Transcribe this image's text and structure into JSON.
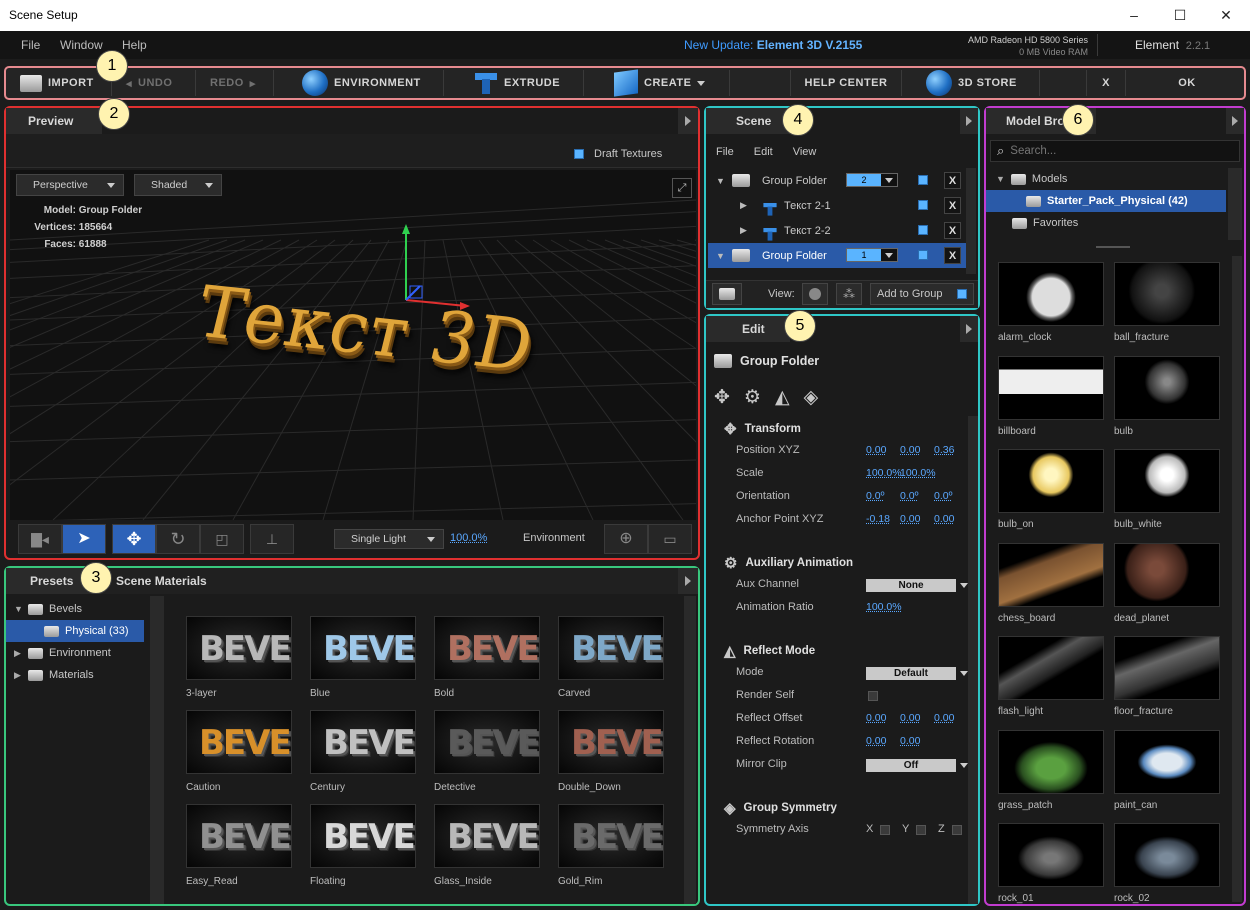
{
  "window": {
    "title": "Scene Setup",
    "min": "–",
    "max": "☐",
    "close": "✕"
  },
  "menu": {
    "file": "File",
    "window": "Window",
    "help": "Help",
    "update_prefix": "New Update:",
    "update_name": "Element 3D V.2155",
    "gpu": "AMD Radeon HD 5800 Series",
    "vram": "0 MB Video RAM",
    "app": "Element",
    "version": "2.2.1"
  },
  "toolbar": {
    "import": "IMPORT",
    "undo": "UNDO",
    "redo": "REDO",
    "environment": "ENVIRONMENT",
    "extrude": "EXTRUDE",
    "create": "CREATE",
    "help_center": "HELP CENTER",
    "store": "3D STORE",
    "x": "X",
    "ok": "OK"
  },
  "badges": [
    "1",
    "2",
    "3",
    "4",
    "5",
    "6"
  ],
  "preview": {
    "tab": "Preview",
    "draft": "Draft Textures",
    "camera": "Perspective",
    "shading": "Shaded",
    "model_label": "Model:",
    "model": "Group Folder",
    "vertices_label": "Vertices:",
    "vertices": "185664",
    "faces_label": "Faces:",
    "faces": "61888",
    "text3d": "Текст 3D",
    "light": "Single Light",
    "light_pct": "100.0%",
    "env": "Environment"
  },
  "presets": {
    "tab1": "Presets",
    "tab2": "Scene Materials",
    "tree": [
      {
        "label": "Bevels",
        "expanded": true
      },
      {
        "label": "Physical (33)",
        "child": true,
        "selected": true
      },
      {
        "label": "Environment"
      },
      {
        "label": "Materials"
      }
    ],
    "items": [
      {
        "name": "3-layer",
        "color": "#b8b8b8"
      },
      {
        "name": "Blue",
        "color": "#9fc8e8"
      },
      {
        "name": "Bold",
        "color": "#b07060"
      },
      {
        "name": "Carved",
        "color": "#7ea8c8"
      },
      {
        "name": "Caution",
        "color": "#d8902a"
      },
      {
        "name": "Century",
        "color": "#c0c0c0"
      },
      {
        "name": "Detective",
        "color": "#5a5a5a"
      },
      {
        "name": "Double_Down",
        "color": "#a06050"
      },
      {
        "name": "Easy_Read",
        "color": "#909090"
      },
      {
        "name": "Floating",
        "color": "#d8d8d8"
      },
      {
        "name": "Glass_Inside",
        "color": "#b8b8b8"
      },
      {
        "name": "Gold_Rim",
        "color": "#6a6a6a"
      }
    ],
    "bevel": "BEVEL"
  },
  "scene": {
    "tab": "Scene",
    "file": "File",
    "edit": "Edit",
    "view": "View",
    "rows": [
      {
        "label": "Group Folder",
        "group": "2",
        "folder": true,
        "open": true,
        "selected": false
      },
      {
        "label": "Текст 2-1",
        "child": true
      },
      {
        "label": "Текст 2-2",
        "child": true
      },
      {
        "label": "Group Folder",
        "group": "1",
        "folder": true,
        "open": true,
        "selected": true
      }
    ],
    "view_label": "View:",
    "add_to_group": "Add to Group"
  },
  "edit": {
    "tab": "Edit",
    "header": "Group Folder",
    "sections": [
      {
        "title": "Transform",
        "icon": "move-icon",
        "props": [
          {
            "label": "Position XYZ",
            "vals": [
              "0.00",
              "0.00",
              "0.36"
            ]
          },
          {
            "label": "Scale",
            "vals": [
              "100.0%",
              "100.0%",
              ""
            ]
          },
          {
            "label": "Orientation",
            "vals": [
              "0.0º",
              "0.0º",
              "0.0º"
            ]
          },
          {
            "label": "Anchor Point XYZ",
            "vals": [
              "-0.18",
              "0.00",
              "0.00"
            ]
          }
        ]
      },
      {
        "title": "Auxiliary Animation",
        "icon": "gears-icon",
        "props": [
          {
            "label": "Aux Channel",
            "box": "None"
          },
          {
            "label": "Animation Ratio",
            "vals": [
              "100.0%"
            ]
          }
        ]
      },
      {
        "title": "Reflect Mode",
        "icon": "reflect-icon",
        "props": [
          {
            "label": "Mode",
            "box": "Default"
          },
          {
            "label": "Render Self",
            "check": true
          },
          {
            "label": "Reflect Offset",
            "vals": [
              "0.00",
              "0.00",
              "0.00"
            ]
          },
          {
            "label": "Reflect Rotation",
            "vals": [
              "0.00",
              "0.00"
            ]
          },
          {
            "label": "Mirror Clip",
            "box": "Off"
          }
        ]
      },
      {
        "title": "Group Symmetry",
        "icon": "symmetry-icon",
        "props": [
          {
            "label": "Symmetry Axis",
            "axes": [
              "X",
              "Y",
              "Z"
            ]
          }
        ]
      }
    ]
  },
  "browser": {
    "tab": "Model Browser",
    "search_placeholder": "Search...",
    "tree": [
      {
        "label": "Models"
      },
      {
        "label": "Starter_Pack_Physical (42)",
        "selected": true
      },
      {
        "label": "Favorites"
      }
    ],
    "models": [
      "alarm_clock",
      "ball_fracture",
      "billboard",
      "bulb",
      "bulb_on",
      "bulb_white",
      "chess_board",
      "dead_planet",
      "flash_light",
      "floor_fracture",
      "grass_patch",
      "paint_can",
      "rock_01",
      "rock_02"
    ]
  },
  "colors": {
    "red": "#e03030",
    "green": "#39c77d",
    "cyan": "#2fc7c7",
    "magenta": "#c23cd0",
    "pink": "#e68a8f"
  }
}
